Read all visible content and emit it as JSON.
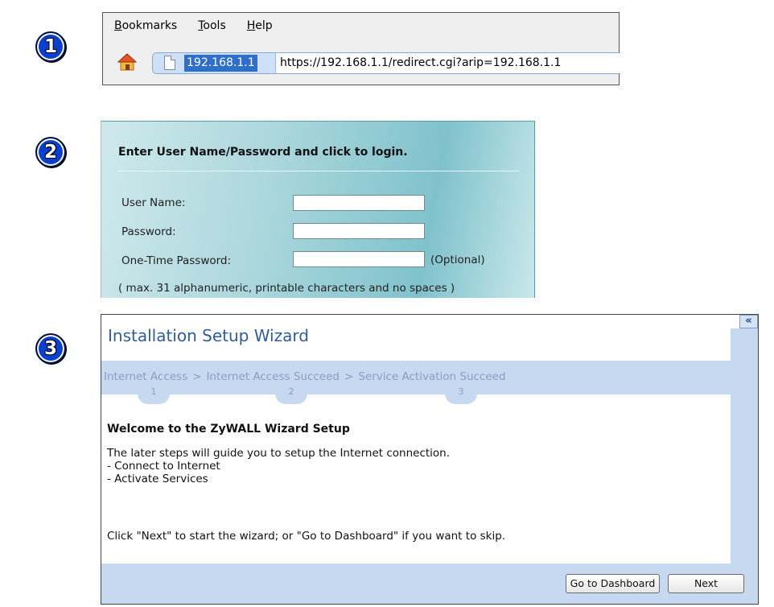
{
  "badges": [
    "1",
    "2",
    "3"
  ],
  "browser": {
    "menu": [
      {
        "label": "Bookmarks",
        "accel": "B",
        "rest": "ookmarks"
      },
      {
        "label": "Tools",
        "accel": "T",
        "rest": "ools"
      },
      {
        "label": "Help",
        "accel": "H",
        "rest": "elp"
      }
    ],
    "site_host": "192.168.1.1",
    "url": "https://192.168.1.1/redirect.cgi?arip=192.168.1.1",
    "icons": {
      "home": "home-icon",
      "page": "page-icon"
    }
  },
  "login": {
    "title": "Enter User Name/Password and click to login.",
    "username_label": "User Name:",
    "password_label": "Password:",
    "otp_label": "One-Time Password:",
    "username_value": "",
    "password_value": "",
    "otp_value": "",
    "optional": "(Optional)",
    "note": "( max. 31 alphanumeric, printable characters and no spaces )"
  },
  "wizard": {
    "title": "Installation Setup Wizard",
    "collapse": "«",
    "steps": [
      {
        "label": "Internet Access",
        "num": "1"
      },
      {
        "label": "Internet Access Succeed",
        "num": "2"
      },
      {
        "label": "Service Activation Succeed",
        "num": "3"
      }
    ],
    "step_separator": ">",
    "welcome": "Welcome to the ZyWALL Wizard Setup",
    "description": "The later steps will guide you to setup the Internet connection.\n- Connect to Internet\n- Activate Services",
    "hint": "Click \"Next\" to start the wizard; or \"Go to Dashboard\" if you want to skip.",
    "buttons": {
      "dashboard": "Go to Dashboard",
      "next": "Next"
    }
  }
}
